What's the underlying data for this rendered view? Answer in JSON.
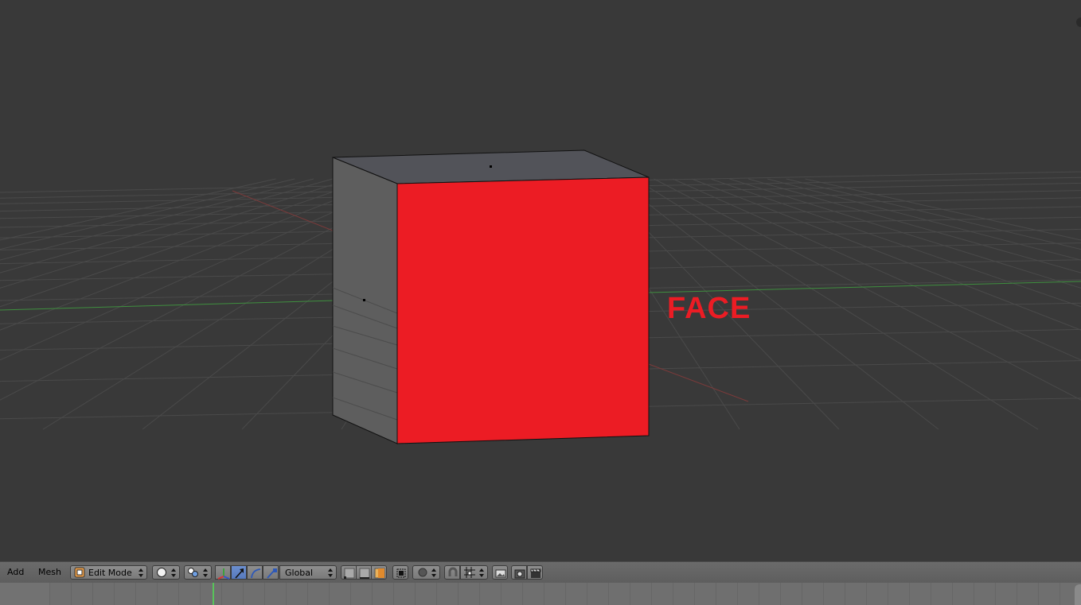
{
  "annotation": {
    "text": "FACE",
    "color": "#ec1c24"
  },
  "viewport": {
    "background": "#393939",
    "selected_face_color": "#ec1c24"
  },
  "header": {
    "menus": [
      "Add",
      "Mesh"
    ],
    "mode": {
      "label": "Edit Mode"
    },
    "orientation": {
      "label": "Global"
    }
  },
  "timeline": {
    "cursor_color": "#58c35a"
  }
}
